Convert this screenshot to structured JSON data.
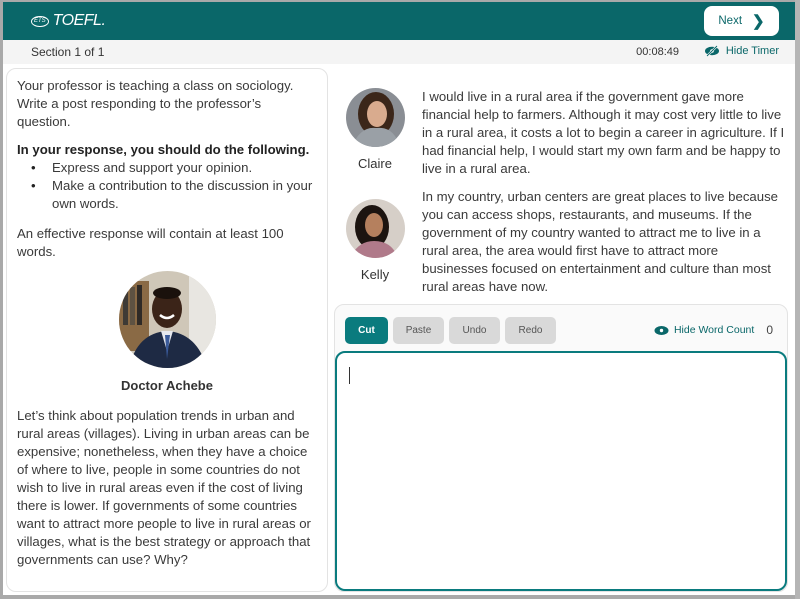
{
  "header": {
    "logo_small": "ETS",
    "logo_main": "TOEFL.",
    "next_label": "Next",
    "brand_color": "#0a6769"
  },
  "subbar": {
    "section": "Section 1 of 1",
    "timer": "00:08:49",
    "hide_timer_label": "Hide Timer"
  },
  "instructions": {
    "intro": "Your professor is teaching a class on sociology. Write a post responding to the professor’s question.",
    "heading": "In your response, you should do the following.",
    "bullets": [
      "Express and support your opinion.",
      "Make a contribution to the discussion in your own words."
    ],
    "length_note": "An effective response will contain at least 100 words."
  },
  "professor": {
    "name": "Doctor Achebe",
    "question": "Let’s think about population trends in urban and rural areas (villages). Living in urban areas can be expensive; nonetheless, when they have a choice of where to live, people in some countries do not wish to live in rural areas even if the cost of living there is lower. If governments of some countries want to attract more people to live in rural areas or villages, what is the best strategy or approach that governments can use? Why?"
  },
  "posts": [
    {
      "name": "Claire",
      "text": "I would live in a rural area if the government gave more financial help to farmers. Although it may cost very little to live in a rural area, it costs a lot to begin a career in agriculture. If I had financial help, I would start my own farm and be happy to live in a rural area."
    },
    {
      "name": "Kelly",
      "text": "In my country, urban centers are great places to live because you can access shops, restaurants, and museums. If the government of my country wanted to attract me to live in a rural area, the area would first have to attract more businesses focused on entertainment and culture than most rural areas have now."
    }
  ],
  "editor": {
    "buttons": [
      "Cut",
      "Paste",
      "Undo",
      "Redo"
    ],
    "hide_word_count_label": "Hide Word Count",
    "word_count": "0",
    "content": ""
  }
}
